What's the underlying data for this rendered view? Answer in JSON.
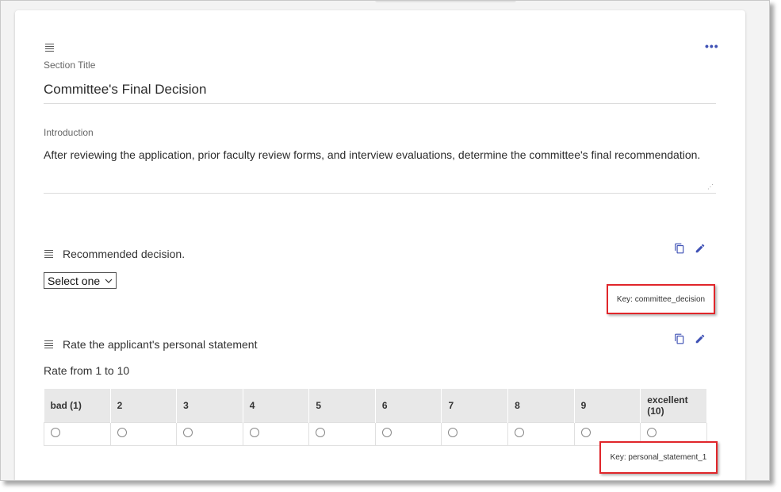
{
  "section": {
    "title_label": "Section Title",
    "title_value": "Committee's Final Decision",
    "intro_label": "Introduction",
    "intro_value": "After reviewing the application, prior faculty review forms, and interview evaluations, determine the committee's final recommendation."
  },
  "questions": [
    {
      "text": "Recommended decision.",
      "select_value": "Select one",
      "key": "Key: committee_decision"
    },
    {
      "text": "Rate the applicant's personal statement",
      "hint": "Rate from 1 to 10",
      "scale_headers": [
        "bad (1)",
        "2",
        "3",
        "4",
        "5",
        "6",
        "7",
        "8",
        "9",
        "excellent (10)"
      ],
      "key": "Key: personal_statement_1"
    }
  ],
  "colors": {
    "accent": "#3f51b5",
    "highlight_border": "#e0262b",
    "table_header_bg": "#e8e8e8"
  },
  "icons": {
    "more": "more-horizontal-icon",
    "drag": "drag-handle-icon",
    "copy": "copy-icon",
    "edit": "pencil-icon",
    "dropdown": "chevron-down-icon"
  }
}
